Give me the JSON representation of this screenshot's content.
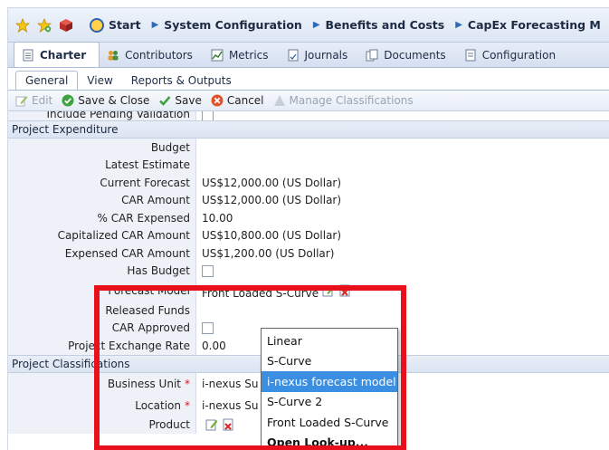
{
  "breadcrumb": {
    "items": [
      {
        "label": "Start"
      },
      {
        "label": "System Configuration"
      },
      {
        "label": "Benefits and Costs"
      },
      {
        "label": "CapEx Forecasting M"
      }
    ]
  },
  "tabs": [
    {
      "label": "Charter",
      "icon": "document-icon"
    },
    {
      "label": "Contributors",
      "icon": "users-icon"
    },
    {
      "label": "Metrics",
      "icon": "chart-icon"
    },
    {
      "label": "Journals",
      "icon": "journal-icon"
    },
    {
      "label": "Documents",
      "icon": "documents-icon"
    },
    {
      "label": "Configuration",
      "icon": "config-icon"
    }
  ],
  "subtabs": [
    "General",
    "View",
    "Reports & Outputs"
  ],
  "toolbar": {
    "edit": "Edit",
    "save_close": "Save & Close",
    "save": "Save",
    "cancel": "Cancel",
    "manage": "Manage Classifications"
  },
  "top_partial_label": "Include Pending Validation",
  "sections": {
    "expenditure": "Project Expenditure",
    "classifications": "Project Classifications"
  },
  "fields": {
    "budget": {
      "label": "Budget",
      "value": ""
    },
    "latest_estimate": {
      "label": "Latest Estimate",
      "value": ""
    },
    "current_forecast": {
      "label": "Current Forecast",
      "value": "US$12,000.00 (US Dollar)"
    },
    "car_amount": {
      "label": "CAR Amount",
      "value": "US$12,000.00 (US Dollar)"
    },
    "car_expensed": {
      "label": "% CAR Expensed",
      "value": "10.00"
    },
    "capitalized_car": {
      "label": "Capitalized CAR Amount",
      "value": "US$10,800.00 (US Dollar)"
    },
    "expensed_car": {
      "label": "Expensed CAR Amount",
      "value": "US$1,200.00 (US Dollar)"
    },
    "has_budget": {
      "label": "Has Budget"
    },
    "forecast_model": {
      "label": "Forecast Model",
      "value": "Front Loaded S-Curve"
    },
    "released_funds": {
      "label": "Released Funds"
    },
    "car_approved": {
      "label": "CAR Approved"
    },
    "exchange_rate": {
      "label": "Project Exchange Rate",
      "value": "0.00"
    },
    "business_unit": {
      "label": "Business Unit",
      "value": "i-nexus Su"
    },
    "location": {
      "label": "Location",
      "value": "i-nexus Su"
    },
    "product": {
      "label": "Product"
    }
  },
  "dropdown": {
    "options": [
      "Linear",
      "S-Curve",
      "i-nexus forecast model",
      "S-Curve 2",
      "Front Loaded S-Curve",
      "Open Look-up..."
    ],
    "highlighted_index": 2
  },
  "colors": {
    "highlight": "#3b8fe2",
    "red_box": "#e8101a",
    "section_bg": "#dbe4f2"
  }
}
